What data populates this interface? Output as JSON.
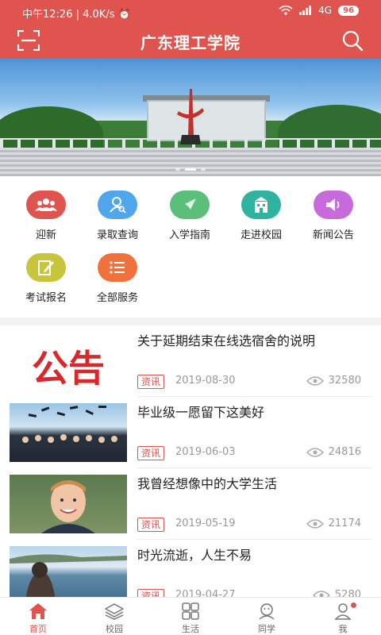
{
  "status_bar": {
    "time": "中午12:26",
    "speed": "4.0K/s",
    "network": "4G",
    "battery": "96"
  },
  "header": {
    "title": "广东理工学院"
  },
  "menu": [
    {
      "label": "迎新",
      "icon": "people-icon",
      "color": "#e0544f"
    },
    {
      "label": "录取查询",
      "icon": "user-search-icon",
      "color": "#4fa6ea"
    },
    {
      "label": "入学指南",
      "icon": "compass-icon",
      "color": "#5bbf7a"
    },
    {
      "label": "走进校园",
      "icon": "school-building-icon",
      "color": "#2db3a0"
    },
    {
      "label": "新闻公告",
      "icon": "speaker-icon",
      "color": "#c76bdc"
    },
    {
      "label": "考试报名",
      "icon": "edit-form-icon",
      "color": "#c8c43b"
    },
    {
      "label": "全部服务",
      "icon": "list-icon",
      "color": "#f0713c"
    }
  ],
  "news": [
    {
      "title": "关于延期结束在线选宿舍的说明",
      "tag": "资讯",
      "date": "2019-08-30",
      "views": "32580",
      "thumb_text": "公告"
    },
    {
      "title": "毕业级一愿留下这美好",
      "tag": "资讯",
      "date": "2019-06-03",
      "views": "24816"
    },
    {
      "title": "我曾经想像中的大学生活",
      "tag": "资讯",
      "date": "2019-05-19",
      "views": "21174"
    },
    {
      "title": "时光流逝，人生不易",
      "tag": "资讯",
      "date": "2019-04-27",
      "views": "5280"
    }
  ],
  "tabs": [
    {
      "label": "首页",
      "icon": "home-icon"
    },
    {
      "label": "校园",
      "icon": "layers-icon"
    },
    {
      "label": "生活",
      "icon": "grid-icon"
    },
    {
      "label": "同学",
      "icon": "classmates-icon"
    },
    {
      "label": "我",
      "icon": "user-icon"
    }
  ],
  "colors": {
    "primary": "#e0544f"
  }
}
